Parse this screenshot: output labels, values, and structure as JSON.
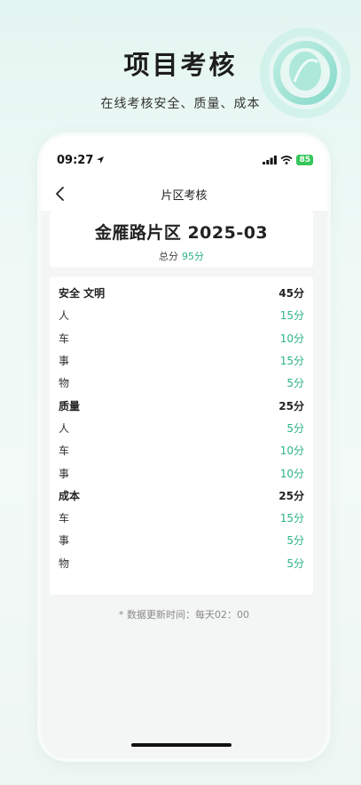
{
  "promo": {
    "title": "项目考核",
    "subtitle": "在线考核安全、质量、成本"
  },
  "status_bar": {
    "time": "09:27",
    "battery": "85"
  },
  "nav": {
    "title": "片区考核"
  },
  "header_card": {
    "title": "金雁路片区 2025-03",
    "total_label": "总分",
    "total_value": "95分"
  },
  "rows": [
    {
      "type": "group",
      "label": "安全 文明",
      "score": "45分"
    },
    {
      "type": "item",
      "label": "人",
      "score": "15分"
    },
    {
      "type": "item",
      "label": "车",
      "score": "10分"
    },
    {
      "type": "item",
      "label": "事",
      "score": "15分"
    },
    {
      "type": "item",
      "label": "物",
      "score": "5分"
    },
    {
      "type": "group",
      "label": "质量",
      "score": "25分"
    },
    {
      "type": "item",
      "label": "人",
      "score": "5分"
    },
    {
      "type": "item",
      "label": "车",
      "score": "10分"
    },
    {
      "type": "item",
      "label": "事",
      "score": "10分"
    },
    {
      "type": "group",
      "label": "成本",
      "score": "25分"
    },
    {
      "type": "item",
      "label": "车",
      "score": "15分"
    },
    {
      "type": "item",
      "label": "事",
      "score": "5分"
    },
    {
      "type": "item",
      "label": "物",
      "score": "5分"
    }
  ],
  "footnote": "* 数据更新时间：每天02：00",
  "colors": {
    "accent": "#2db38a",
    "battery": "#35c759"
  },
  "icons": [
    "decorative-leaf-rings-icon",
    "location-arrow-icon",
    "signal-icon",
    "wifi-icon",
    "battery-icon",
    "back-chevron-icon"
  ]
}
